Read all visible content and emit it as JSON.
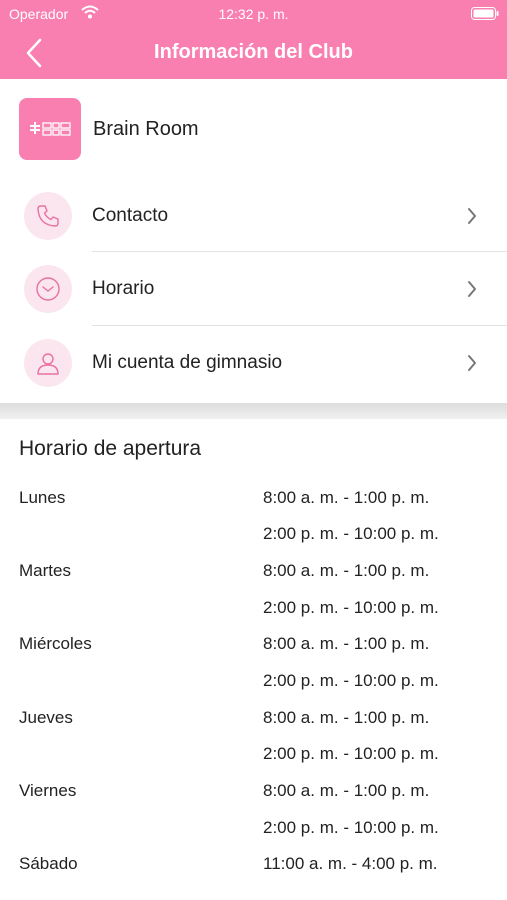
{
  "status_bar": {
    "carrier": "Operador",
    "time": "12:32 p. m."
  },
  "nav": {
    "title": "Información del Club"
  },
  "club": {
    "name": "Brain Room",
    "logo_text": "BRAIN ROOM"
  },
  "menu": [
    {
      "label": "Contacto",
      "icon": "phone-icon"
    },
    {
      "label": "Horario",
      "icon": "clock-icon"
    },
    {
      "label": "Mi cuenta de gimnasio",
      "icon": "user-icon"
    }
  ],
  "hours": {
    "title": "Horario de apertura",
    "rows": [
      {
        "day": "Lunes",
        "time": "8:00 a. m. - 1:00 p. m."
      },
      {
        "day": "",
        "time": "2:00 p. m. - 10:00 p. m."
      },
      {
        "day": "Martes",
        "time": "8:00 a. m. - 1:00 p. m."
      },
      {
        "day": "",
        "time": "2:00 p. m. - 10:00 p. m."
      },
      {
        "day": "Miércoles",
        "time": "8:00 a. m. - 1:00 p. m."
      },
      {
        "day": "",
        "time": "2:00 p. m. - 10:00 p. m."
      },
      {
        "day": "Jueves",
        "time": "8:00 a. m. - 1:00 p. m."
      },
      {
        "day": "",
        "time": "2:00 p. m. - 10:00 p. m."
      },
      {
        "day": "Viernes",
        "time": "8:00 a. m. - 1:00 p. m."
      },
      {
        "day": "",
        "time": "2:00 p. m. - 10:00 p. m."
      },
      {
        "day": "Sábado",
        "time": "11:00 a. m. - 4:00 p. m."
      }
    ]
  },
  "colors": {
    "accent": "#f97fb0",
    "icon_bg": "#fbe6ef",
    "icon_stroke": "#e8709f"
  }
}
